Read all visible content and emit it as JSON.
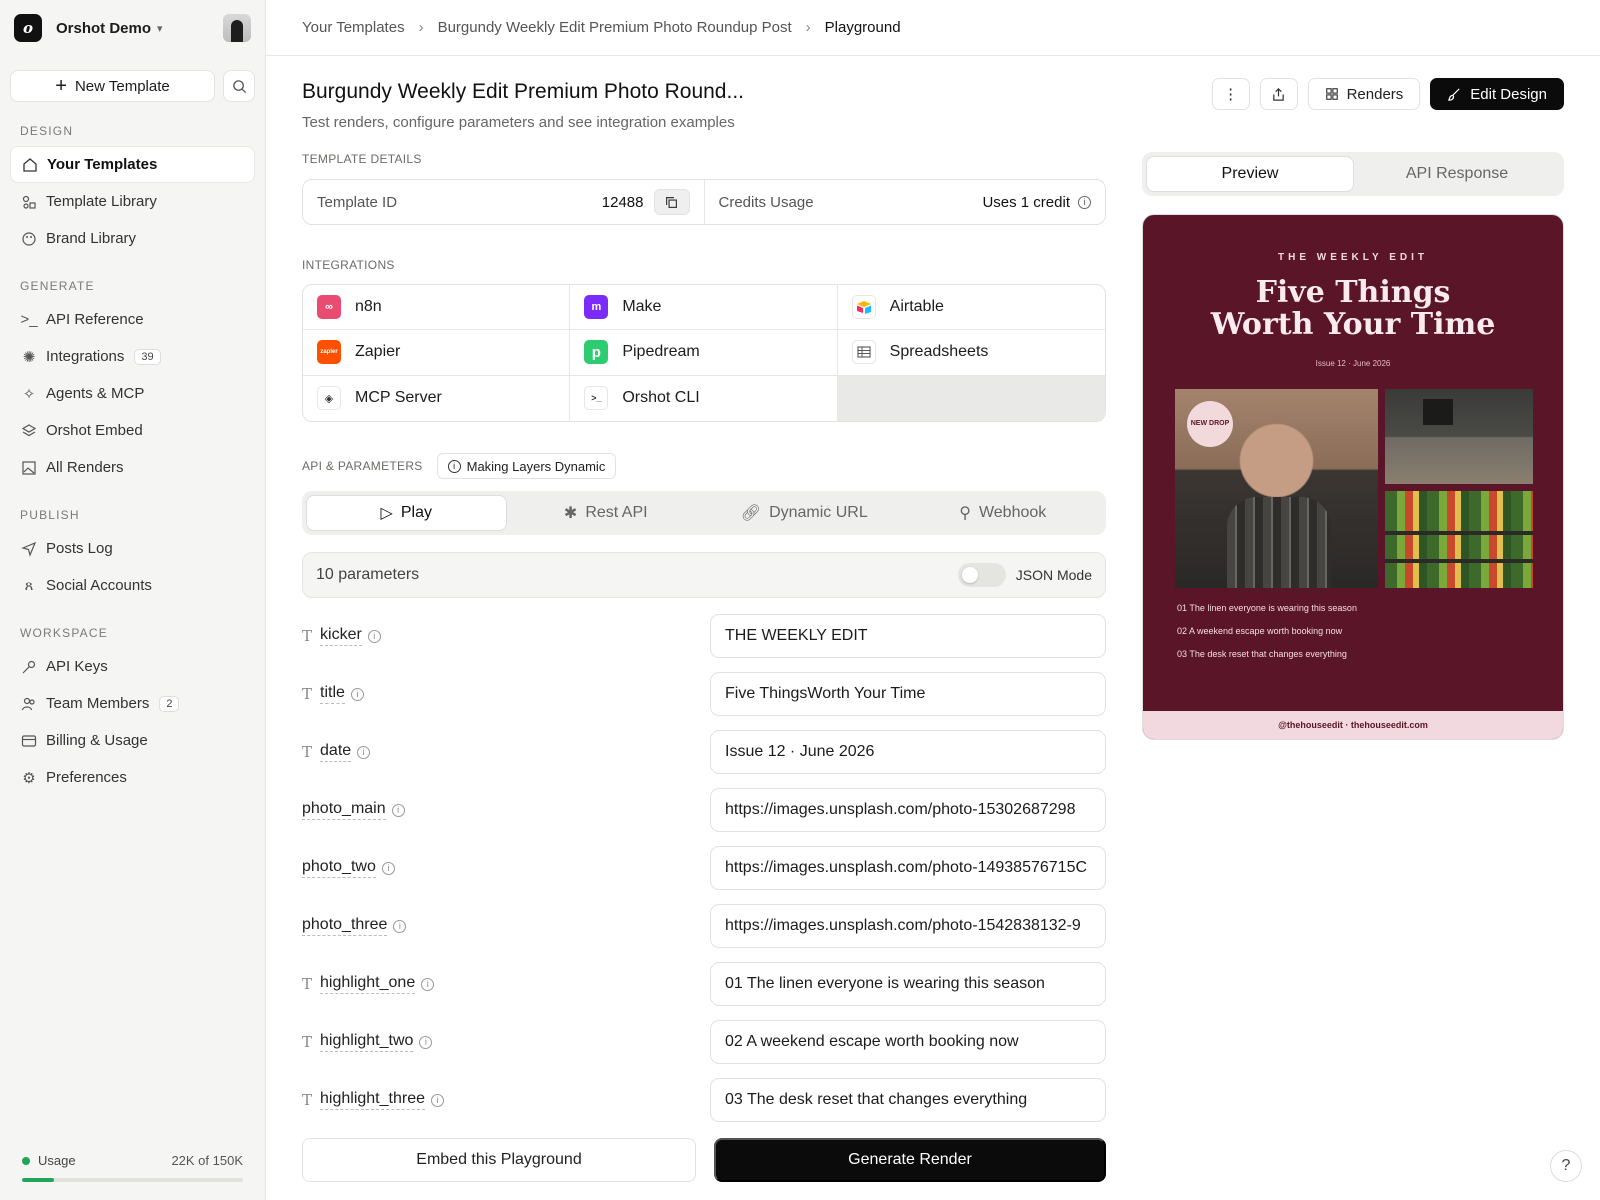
{
  "workspace": {
    "name": "Orshot Demo"
  },
  "sidebar": {
    "new_template": "New Template",
    "sections": [
      {
        "label": "DESIGN",
        "items": [
          {
            "label": "Your Templates",
            "icon": "home-icon",
            "active": true
          },
          {
            "label": "Template Library",
            "icon": "shapes-icon"
          },
          {
            "label": "Brand Library",
            "icon": "palette-icon"
          }
        ]
      },
      {
        "label": "GENERATE",
        "items": [
          {
            "label": "API Reference",
            "icon": "terminal-icon"
          },
          {
            "label": "Integrations",
            "icon": "plug-icon",
            "badge": "39"
          },
          {
            "label": "Agents & MCP",
            "icon": "sparkles-icon"
          },
          {
            "label": "Orshot Embed",
            "icon": "layers-icon"
          },
          {
            "label": "All Renders",
            "icon": "image-icon"
          }
        ]
      },
      {
        "label": "PUBLISH",
        "items": [
          {
            "label": "Posts Log",
            "icon": "send-icon"
          },
          {
            "label": "Social Accounts",
            "icon": "users-list-icon"
          }
        ]
      },
      {
        "label": "WORKSPACE",
        "items": [
          {
            "label": "API Keys",
            "icon": "key-icon"
          },
          {
            "label": "Team Members",
            "icon": "team-icon",
            "badge": "2"
          },
          {
            "label": "Billing & Usage",
            "icon": "card-icon"
          },
          {
            "label": "Preferences",
            "icon": "gear-icon"
          }
        ]
      }
    ],
    "usage": {
      "label": "Usage",
      "value": "22K of 150K",
      "fraction": 0.147,
      "color": "#22a559"
    }
  },
  "breadcrumb": [
    "Your Templates",
    "Burgundy Weekly Edit Premium Photo Roundup Post",
    "Playground"
  ],
  "header": {
    "title": "Burgundy Weekly Edit Premium Photo Round...",
    "subtitle": "Test renders, configure parameters and see integration examples",
    "renders_label": "Renders",
    "edit_label": "Edit Design"
  },
  "details": {
    "section_label": "TEMPLATE DETAILS",
    "template_id_label": "Template ID",
    "template_id": "12488",
    "credits_label": "Credits Usage",
    "credits_value": "Uses 1 credit"
  },
  "integrations": {
    "section_label": "INTEGRATIONS",
    "items": [
      {
        "label": "n8n",
        "color": "#ea4b71"
      },
      {
        "label": "Make",
        "color": "#7b2bf9"
      },
      {
        "label": "Airtable",
        "color": "#fcb400"
      },
      {
        "label": "Zapier",
        "color": "#ff4f00"
      },
      {
        "label": "Pipedream",
        "color": "#2dcc70"
      },
      {
        "label": "Spreadsheets",
        "color": "#ffffff"
      },
      {
        "label": "MCP Server",
        "color": "#ffffff"
      },
      {
        "label": "Orshot CLI",
        "color": "#ffffff"
      }
    ]
  },
  "api": {
    "section_label": "API & PARAMETERS",
    "dynamic_chip": "Making Layers Dynamic",
    "tabs": [
      "Play",
      "Rest API",
      "Dynamic URL",
      "Webhook"
    ],
    "params_count": "10 parameters",
    "json_mode": "JSON Mode"
  },
  "params": [
    {
      "key": "kicker",
      "text": true,
      "value": "THE WEEKLY EDIT"
    },
    {
      "key": "title",
      "text": true,
      "value": "Five ThingsWorth Your Time"
    },
    {
      "key": "date",
      "text": true,
      "value": "Issue 12  ·  June 2026"
    },
    {
      "key": "photo_main",
      "text": false,
      "value": "https://images.unsplash.com/photo-15302687298"
    },
    {
      "key": "photo_two",
      "text": false,
      "value": "https://images.unsplash.com/photo-14938576715C"
    },
    {
      "key": "photo_three",
      "text": false,
      "value": "https://images.unsplash.com/photo-1542838132-9"
    },
    {
      "key": "highlight_one",
      "text": true,
      "value": "01    The linen everyone is wearing this season"
    },
    {
      "key": "highlight_two",
      "text": true,
      "value": "02    A weekend escape worth booking now"
    },
    {
      "key": "highlight_three",
      "text": true,
      "value": "03    The desk reset that changes everything"
    }
  ],
  "buttons": {
    "embed": "Embed this Playground",
    "generate": "Generate Render"
  },
  "preview": {
    "tabs": [
      "Preview",
      "API Response"
    ],
    "kicker": "THE WEEKLY EDIT",
    "title_line1": "Five Things",
    "title_line2": "Worth Your Time",
    "date": "Issue 12 · June 2026",
    "badge": "NEW DROP",
    "highlights": [
      "01 The linen everyone is wearing this season",
      "02 A weekend escape worth booking now",
      "03 The desk reset that changes everything"
    ],
    "footer": "@thehouseedit · thehouseedit.com",
    "bg_color": "#5a1628"
  },
  "help": "?"
}
